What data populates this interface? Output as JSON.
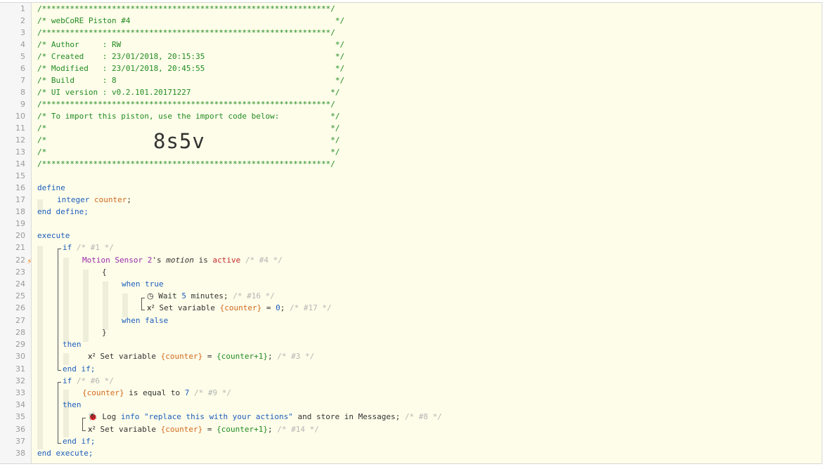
{
  "import_code": "8s5v",
  "line_numbers": [
    "1",
    "2",
    "3",
    "4",
    "5",
    "6",
    "7",
    "8",
    "9",
    "10",
    "11",
    "12",
    "13",
    "14",
    "15",
    "16",
    "17",
    "18",
    "19",
    "20",
    "21",
    "22",
    "23",
    "24",
    "25",
    "26",
    "27",
    "28",
    "29",
    "30",
    "31",
    "32",
    "33",
    "34",
    "35",
    "36",
    "37",
    "38"
  ],
  "header": {
    "stars_open": "/**************************************************************/",
    "title": "/* webCoRE Piston #4                                            */",
    "author": "/* Author     : RW                                              */",
    "created": "/* Created    : 23/01/2018, 20:15:35                            */",
    "modified": "/* Modified   : 23/01/2018, 20:45:55                            */",
    "build": "/* Build      : 8                                               */",
    "ui_version": "/* UI version : v0.2.101.20171227                              */",
    "import_text": "/* To import this piston, use the import code below:           */",
    "blank": "/*                                                             */",
    "stars_close": "/**************************************************************/"
  },
  "code": {
    "define": "define",
    "integer": "integer",
    "counter": "counter",
    "semicolon": ";",
    "end_define": "end define;",
    "execute": "execute",
    "if": "if",
    "c1": "/* #1 */",
    "device": "Motion Sensor 2",
    "apos_s": "'s",
    "motion": "motion",
    "is": "is",
    "active": "active",
    "c4": "/* #4 */",
    "brace_open": "{",
    "when_true": "when true",
    "wait": "Wait",
    "five": "5",
    "minutes": "minutes;",
    "c16": "/* #16 */",
    "set_variable": "Set variable",
    "counter_var": "{counter}",
    "equals": "=",
    "zero": "0",
    "c17": "/* #17 */",
    "when_false": "when false",
    "brace_close": "}",
    "then": "then",
    "counter_plus": "{counter+1}",
    "c3": "/* #3 */",
    "end_if": "end if;",
    "c6": "/* #6 */",
    "is_equal_to": "is equal to",
    "seven": "7",
    "c9": "/* #9 */",
    "log": "Log",
    "info": "info",
    "msg": "\"replace this with your actions\"",
    "store": "and store in Messages;",
    "c8": "/* #8 */",
    "c14": "/* #14 */",
    "end_execute": "end execute;"
  },
  "icons": {
    "bolt": "⚡",
    "clock": "◷",
    "x2": "x²",
    "bug": "🐞"
  }
}
